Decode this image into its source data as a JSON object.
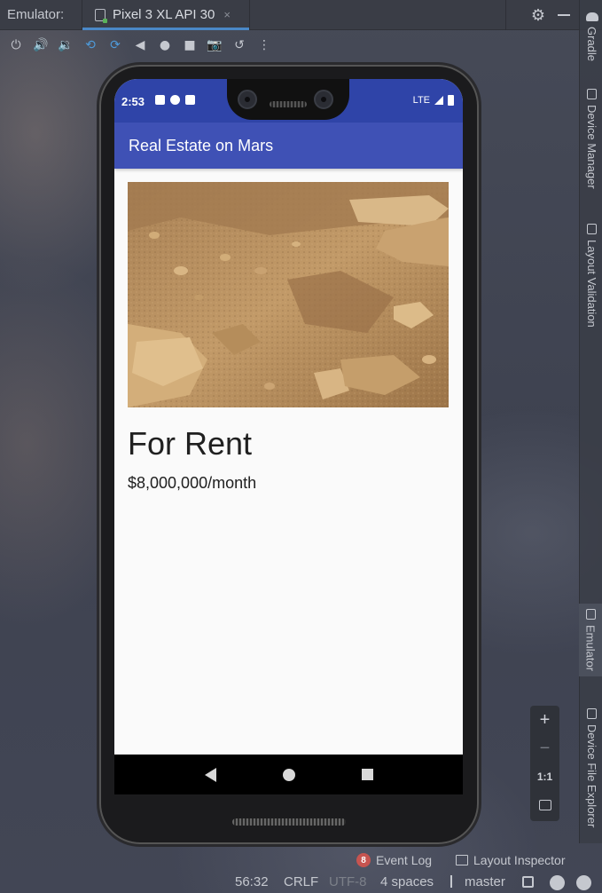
{
  "ide": {
    "panel_label": "Emulator:",
    "device_tab": "Pixel 3 XL API 30",
    "close_glyph": "×",
    "settings_glyph": "⚙",
    "toolbar_glyphs": [
      "⏻",
      "🔊",
      "🔉",
      "⟲",
      "⟳",
      "◀",
      "●",
      "■",
      "📷",
      "↺",
      "⋮"
    ]
  },
  "side_tabs": [
    "Gradle",
    "Device Manager",
    "Layout Validation",
    "Emulator",
    "Device File Explorer"
  ],
  "device": {
    "status_time": "2:53",
    "status_network": "LTE",
    "app_title": "Real Estate on Mars",
    "property_type": "For Rent",
    "property_price": "$8,000,000/month"
  },
  "zoom": {
    "zoom_in": "+",
    "zoom_out": "−",
    "actual_size": "1:1"
  },
  "bottom": {
    "event_log_count": "8",
    "event_log": "Event Log",
    "layout_inspector": "Layout Inspector"
  },
  "statusline": {
    "position": "56:32",
    "line_sep": "CRLF",
    "encoding": "UTF-8",
    "indent": "4 spaces",
    "branch": "master"
  },
  "colors": {
    "status_bar": "#2f44a8",
    "app_bar": "#3f51b5",
    "tab_accent": "#4a88c7"
  }
}
